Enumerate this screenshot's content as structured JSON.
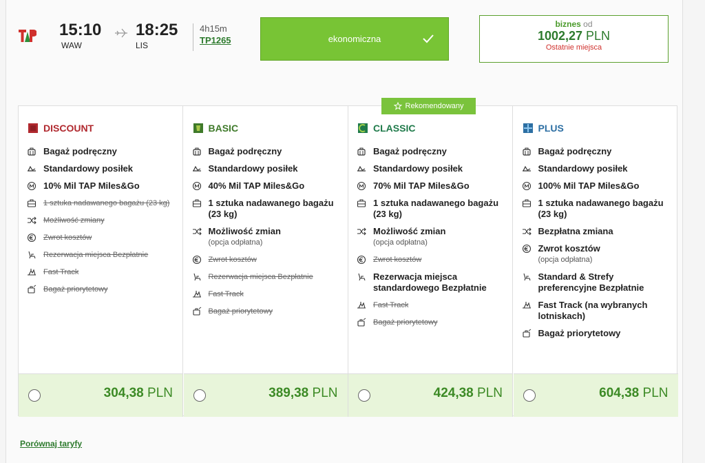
{
  "flight": {
    "dep_time": "15:10",
    "dep_airport": "WAW",
    "arr_time": "18:25",
    "arr_airport": "LIS",
    "duration": "4h15m",
    "flight_number": "TP1265"
  },
  "economy": {
    "label": "ekonomiczna"
  },
  "business": {
    "label": "biznes",
    "from": "od",
    "price_value": "1002,27",
    "currency": "PLN",
    "note": "Ostatnie miejsca"
  },
  "recommended_label": "Rekomendowany",
  "fares": [
    {
      "name": "DISCOUNT",
      "color": "#b0282e",
      "price_value": "304,38",
      "currency": "PLN",
      "features": [
        {
          "icon": "luggage-icon",
          "text": "Bagaż podręczny",
          "sub": "",
          "included": true
        },
        {
          "icon": "meal-icon",
          "text": "Standardowy posiłek",
          "sub": "",
          "included": true
        },
        {
          "icon": "miles-icon",
          "text": "10% Mil TAP Miles&Go",
          "sub": "",
          "included": true
        },
        {
          "icon": "checked-bag-icon",
          "text": "1 sztuka nadawanego bagażu (23 kg)",
          "sub": "",
          "included": false
        },
        {
          "icon": "change-icon",
          "text": "Możliwość zmiany",
          "sub": "",
          "included": false
        },
        {
          "icon": "refund-icon",
          "text": "Zwrot kosztów",
          "sub": "",
          "included": false
        },
        {
          "icon": "seat-icon",
          "text": "Rezerwacja miejsca Bezpłatnie",
          "sub": "",
          "included": false
        },
        {
          "icon": "fast-track-icon",
          "text": "Fast Track",
          "sub": "",
          "included": false
        },
        {
          "icon": "priority-bag-icon",
          "text": "Bagaż priorytetowy",
          "sub": "",
          "included": false
        }
      ]
    },
    {
      "name": "BASIC",
      "color": "#3f7a2a",
      "price_value": "389,38",
      "currency": "PLN",
      "features": [
        {
          "icon": "luggage-icon",
          "text": "Bagaż podręczny",
          "sub": "",
          "included": true
        },
        {
          "icon": "meal-icon",
          "text": "Standardowy posiłek",
          "sub": "",
          "included": true
        },
        {
          "icon": "miles-icon",
          "text": "40% Mil TAP Miles&Go",
          "sub": "",
          "included": true
        },
        {
          "icon": "checked-bag-icon",
          "text": "1 sztuka nadawanego bagażu (23 kg)",
          "sub": "",
          "included": true
        },
        {
          "icon": "change-icon",
          "text": "Możliwość zmian",
          "sub": "(opcja odpłatna)",
          "included": true
        },
        {
          "icon": "refund-icon",
          "text": "Zwrot kosztów",
          "sub": "",
          "included": false
        },
        {
          "icon": "seat-icon",
          "text": "Rezerwacja miejsca Bezpłatnie",
          "sub": "",
          "included": false
        },
        {
          "icon": "fast-track-icon",
          "text": "Fast Track",
          "sub": "",
          "included": false
        },
        {
          "icon": "priority-bag-icon",
          "text": "Bagaż priorytetowy",
          "sub": "",
          "included": false
        }
      ]
    },
    {
      "name": "CLASSIC",
      "color": "#1f7a4a",
      "price_value": "424,38",
      "currency": "PLN",
      "features": [
        {
          "icon": "luggage-icon",
          "text": "Bagaż podręczny",
          "sub": "",
          "included": true
        },
        {
          "icon": "meal-icon",
          "text": "Standardowy posiłek",
          "sub": "",
          "included": true
        },
        {
          "icon": "miles-icon",
          "text": "70% Mil TAP Miles&Go",
          "sub": "",
          "included": true
        },
        {
          "icon": "checked-bag-icon",
          "text": "1 sztuka nadawanego bagażu (23 kg)",
          "sub": "",
          "included": true
        },
        {
          "icon": "change-icon",
          "text": "Możliwość zmian",
          "sub": "(opcja odpłatna)",
          "included": true
        },
        {
          "icon": "refund-icon",
          "text": "Zwrot kosztów",
          "sub": "",
          "included": false
        },
        {
          "icon": "seat-icon",
          "text": "Rezerwacja miejsca standardowego Bezpłatnie",
          "sub": "",
          "included": true
        },
        {
          "icon": "fast-track-icon",
          "text": "Fast Track",
          "sub": "",
          "included": false
        },
        {
          "icon": "priority-bag-icon",
          "text": "Bagaż priorytetowy",
          "sub": "",
          "included": false
        }
      ]
    },
    {
      "name": "PLUS",
      "color": "#2d6fa3",
      "price_value": "604,38",
      "currency": "PLN",
      "features": [
        {
          "icon": "luggage-icon",
          "text": "Bagaż podręczny",
          "sub": "",
          "included": true
        },
        {
          "icon": "meal-icon",
          "text": "Standardowy posiłek",
          "sub": "",
          "included": true
        },
        {
          "icon": "miles-icon",
          "text": "100% Mil TAP Miles&Go",
          "sub": "",
          "included": true
        },
        {
          "icon": "checked-bag-icon",
          "text": "1 sztuka nadawanego bagażu (23 kg)",
          "sub": "",
          "included": true
        },
        {
          "icon": "change-icon",
          "text": "Bezpłatna zmiana",
          "sub": "",
          "included": true
        },
        {
          "icon": "refund-icon",
          "text": "Zwrot kosztów",
          "sub": "(opcja odpłatna)",
          "included": true
        },
        {
          "icon": "seat-icon",
          "text": "Standard & Strefy preferencyjne Bezpłatnie",
          "sub": "",
          "included": true
        },
        {
          "icon": "fast-track-icon",
          "text": "Fast Track (na wybranych lotniskach)",
          "sub": "",
          "included": true
        },
        {
          "icon": "priority-bag-icon",
          "text": "Bagaż priorytetowy",
          "sub": "",
          "included": true
        }
      ]
    }
  ],
  "compare_link": "Porównaj taryfy"
}
